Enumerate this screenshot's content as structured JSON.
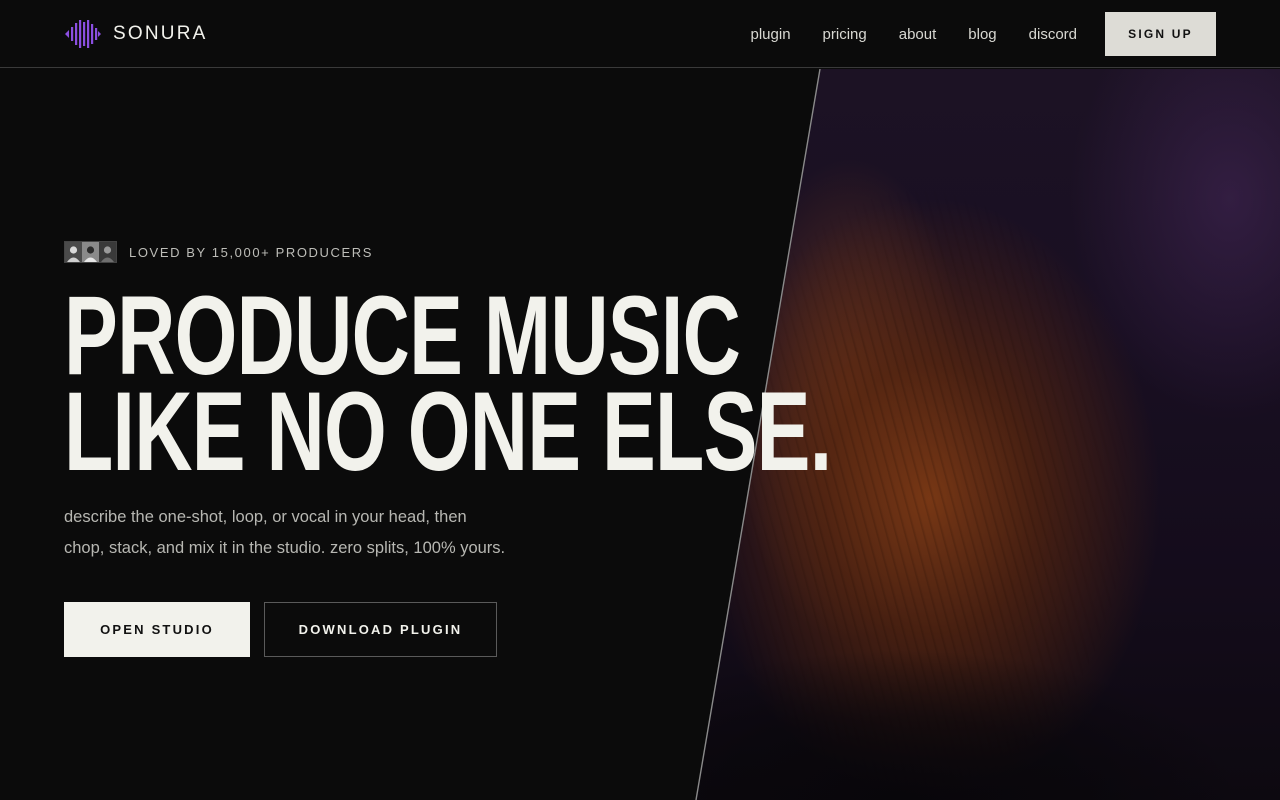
{
  "header": {
    "brand_name": "SONURA",
    "logo_icon": "waveform-logo-icon",
    "nav": [
      {
        "label": "plugin"
      },
      {
        "label": "pricing"
      },
      {
        "label": "about"
      },
      {
        "label": "blog"
      },
      {
        "label": "discord"
      }
    ],
    "signup_label": "SIGN UP"
  },
  "hero": {
    "social_proof": "LOVED BY 15,000+ PRODUCERS",
    "avatar_count": 3,
    "headline_line1": "PRODUCE MUSIC",
    "headline_line2": "LIKE NO ONE ELSE.",
    "subtext_line1": "describe the one-shot, loop, or vocal in your head, then",
    "subtext_line2": "chop, stack, and mix it in the studio. zero splits, 100% yours.",
    "primary_cta": "OPEN STUDIO",
    "secondary_cta": "DOWNLOAD PLUGIN"
  },
  "colors": {
    "background": "#0b0b0b",
    "text": "#f2f2ec",
    "brand_purple": "#8b4fe0",
    "signup_bg": "#dddcd6"
  }
}
